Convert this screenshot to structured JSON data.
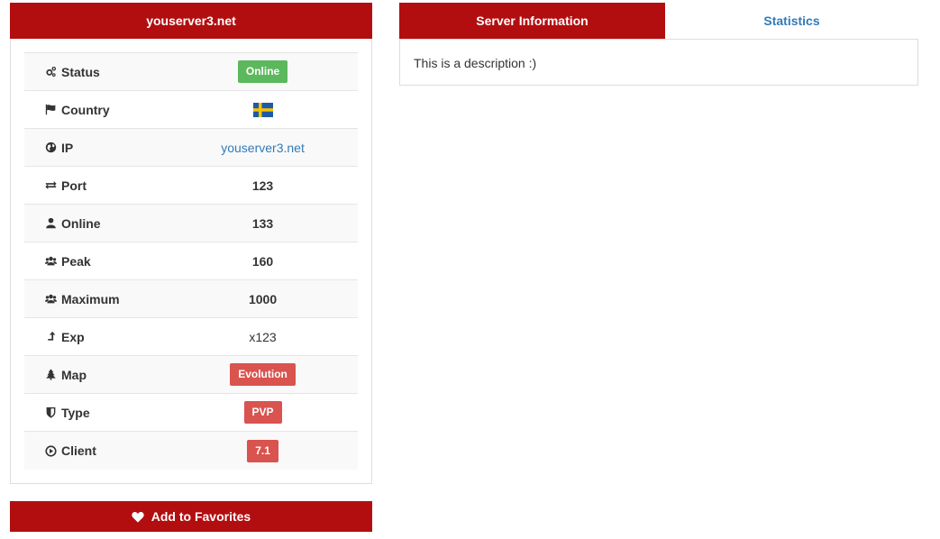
{
  "server": {
    "title": "youserver3.net"
  },
  "rows": [
    {
      "key": "status",
      "label": "Status",
      "icon": "gears-icon",
      "value": "Online",
      "type": "badge-green"
    },
    {
      "key": "country",
      "label": "Country",
      "icon": "flag-icon",
      "value": "",
      "type": "flag"
    },
    {
      "key": "ip",
      "label": "IP",
      "icon": "globe-icon",
      "value": "youserver3.net",
      "type": "link"
    },
    {
      "key": "port",
      "label": "Port",
      "icon": "exchange-icon",
      "value": "123",
      "type": "bold"
    },
    {
      "key": "online",
      "label": "Online",
      "icon": "user-icon",
      "value": "133",
      "type": "bold"
    },
    {
      "key": "peak",
      "label": "Peak",
      "icon": "users-icon",
      "value": "160",
      "type": "bold"
    },
    {
      "key": "maximum",
      "label": "Maximum",
      "icon": "users-icon",
      "value": "1000",
      "type": "bold"
    },
    {
      "key": "exp",
      "label": "Exp",
      "icon": "level-up-icon",
      "value": "x123",
      "type": "plain"
    },
    {
      "key": "map",
      "label": "Map",
      "icon": "tree-icon",
      "value": "Evolution",
      "type": "badge-red"
    },
    {
      "key": "type",
      "label": "Type",
      "icon": "shield-icon",
      "value": "PVP",
      "type": "badge-red"
    },
    {
      "key": "client",
      "label": "Client",
      "icon": "play-circle-icon",
      "value": "7.1",
      "type": "badge-red"
    }
  ],
  "favorites": {
    "label": "Add to Favorites",
    "icon": "heart-icon"
  },
  "tabs": [
    {
      "label": "Server Information",
      "active": true
    },
    {
      "label": "Statistics",
      "active": false
    }
  ],
  "description": "This is a description :)",
  "colors": {
    "brand_red": "#b20e10",
    "badge_green": "#5cb85c",
    "badge_red": "#d9534f",
    "link_blue": "#337ab7"
  }
}
